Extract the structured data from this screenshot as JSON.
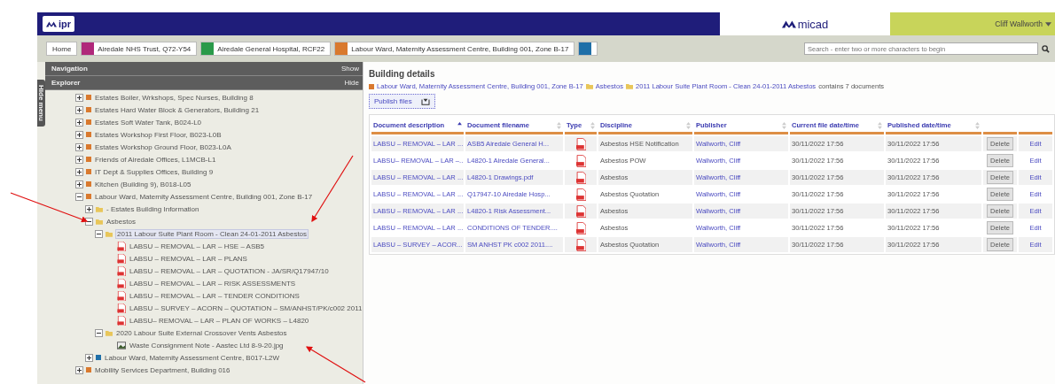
{
  "header": {
    "logo": "ipr",
    "product_logo": "micad",
    "user": "Cliff Wallworth"
  },
  "breadcrumb": {
    "home": "Home",
    "items": [
      {
        "label": "Airedale NHS Trust, Q72-Y54",
        "color": "#b0287a"
      },
      {
        "label": "Airedale General Hospital, RCF22",
        "color": "#2a9a4a"
      },
      {
        "label": "Labour Ward, Maternity Assessment Centre, Building 001, Zone B-17",
        "color": "#d9792e"
      },
      {
        "color": "#1f6fa8"
      }
    ]
  },
  "search": {
    "placeholder": "Search - enter two or more characters to begin"
  },
  "sidebar": {
    "toggle_tab": "Hide menu",
    "navigation": {
      "title": "Navigation",
      "action": "Show"
    },
    "explorer": {
      "title": "Explorer",
      "action": "Hide"
    },
    "tree": [
      {
        "label": "Estates Boiler, Wrkshops, Spec Nurses, Building 8",
        "kind": "building",
        "color": "#d9792e",
        "expanded": false,
        "selected": false
      },
      {
        "label": "Estates Hard Water Block & Generators, Building 21",
        "kind": "building",
        "color": "#d9792e",
        "expanded": false,
        "selected": false
      },
      {
        "label": "Estates Soft Water Tank, B024-L0",
        "kind": "building",
        "color": "#d9792e",
        "expanded": false,
        "selected": false
      },
      {
        "label": "Estates Workshop First Floor, B023-L0B",
        "kind": "building",
        "color": "#d9792e",
        "expanded": false,
        "selected": false
      },
      {
        "label": "Estates Workshop Ground Floor, B023-L0A",
        "kind": "building",
        "color": "#d9792e",
        "expanded": false,
        "selected": false
      },
      {
        "label": "Friends of Airedale Offices, L1MCB-L1",
        "kind": "building",
        "color": "#d9792e",
        "expanded": false,
        "selected": false
      },
      {
        "label": "IT Dept & Supplies Offices, Building 9",
        "kind": "building",
        "color": "#d9792e",
        "expanded": false,
        "selected": false
      },
      {
        "label": "Kitchen (Building 9), B018-L05",
        "kind": "building",
        "color": "#d9792e",
        "expanded": false,
        "selected": false
      },
      {
        "label": "Labour Ward, Maternity Assessment Centre, Building 001, Zone B-17",
        "kind": "building",
        "color": "#d9792e",
        "expanded": true,
        "selected": false,
        "children": [
          {
            "label": "- Estates Building Information",
            "kind": "folder",
            "expanded": false,
            "selected": false
          },
          {
            "label": "Asbestos",
            "kind": "folder",
            "expanded": true,
            "selected": false,
            "children": [
              {
                "label": "2011 Labour Suite Plant Room - Clean 24-01-2011 Asbestos",
                "kind": "folder",
                "expanded": true,
                "selected": true,
                "children": [
                  {
                    "label": "LABSU – REMOVAL – LAR – HSE – ASB5",
                    "kind": "pdf",
                    "selected": false
                  },
                  {
                    "label": "LABSU – REMOVAL – LAR – PLANS",
                    "kind": "pdf",
                    "selected": false
                  },
                  {
                    "label": "LABSU – REMOVAL – LAR – QUOTATION - JA/SR/Q17947/10",
                    "kind": "pdf",
                    "selected": false
                  },
                  {
                    "label": "LABSU – REMOVAL – LAR – RISK ASSESSMENTS",
                    "kind": "pdf",
                    "selected": false
                  },
                  {
                    "label": "LABSU – REMOVAL – LAR – TENDER CONDITIONS",
                    "kind": "pdf",
                    "selected": false
                  },
                  {
                    "label": "LABSU – SURVEY – ACORN – QUOTATION – SM/ANHST/PK/c002 2011",
                    "kind": "pdf",
                    "selected": false
                  },
                  {
                    "label": "LABSU– REMOVAL – LAR – PLAN OF WORKS – L4820",
                    "kind": "pdf",
                    "selected": false
                  }
                ]
              },
              {
                "label": "2020 Labour Suite External Crossover Vents Asbestos",
                "kind": "folder",
                "expanded": true,
                "selected": false,
                "children": [
                  {
                    "label": "Waste Consignment Note - Aastec Ltd 8-9-20.jpg",
                    "kind": "image",
                    "selected": false
                  }
                ]
              }
            ]
          },
          {
            "label": "Labour Ward, Maternity Assessment Centre, B017-L2W",
            "kind": "building",
            "color": "#1f6fa8",
            "expanded": false,
            "selected": false
          }
        ]
      },
      {
        "label": "Mobility Services Department, Building 016",
        "kind": "building",
        "color": "#d9792e",
        "expanded": false,
        "selected": false
      }
    ]
  },
  "details": {
    "title": "Building details",
    "path": [
      {
        "label": "Labour Ward, Maternity Assessment Centre, Building 001, Zone B-17",
        "kind": "building"
      },
      {
        "label": "Asbestos",
        "kind": "folder"
      },
      {
        "label": "2011 Labour Suite Plant Room - Clean 24-01-2011 Asbestos",
        "kind": "folder"
      }
    ],
    "summary": "contains 7 documents",
    "publish_button": "Publish files",
    "table": {
      "columns": [
        {
          "label": "Document description",
          "sorted": true
        },
        {
          "label": "Document filename",
          "sorted": false
        },
        {
          "label": "Type",
          "sorted": false
        },
        {
          "label": "Discipline",
          "sorted": false
        },
        {
          "label": "Publisher",
          "sorted": false
        },
        {
          "label": "Current file date/time",
          "sorted": false
        },
        {
          "label": "Published date/time",
          "sorted": false
        }
      ],
      "rows": [
        {
          "description": "LABSU – REMOVAL – LAR ...",
          "filename": "ASB5 Airedale General H...",
          "discipline": "Asbestos HSE Notification",
          "publisher": "Wallworth, Cliff",
          "current": "30/11/2022 17:56",
          "published": "30/11/2022 17:56",
          "delete": "Delete",
          "edit": "Edit"
        },
        {
          "description": "LABSU– REMOVAL – LAR –...",
          "filename": "L4820-1 Airedale General...",
          "discipline": "Asbestos POW",
          "publisher": "Wallworth, Cliff",
          "current": "30/11/2022 17:56",
          "published": "30/11/2022 17:56",
          "delete": "Delete",
          "edit": "Edit"
        },
        {
          "description": "LABSU – REMOVAL – LAR ...",
          "filename": "L4820-1 Drawings.pdf",
          "discipline": "Asbestos",
          "publisher": "Wallworth, Cliff",
          "current": "30/11/2022 17:56",
          "published": "30/11/2022 17:56",
          "delete": "Delete",
          "edit": "Edit"
        },
        {
          "description": "LABSU – REMOVAL – LAR ...",
          "filename": "Q17947-10 Airedale Hosp...",
          "discipline": "Asbestos Quotation",
          "publisher": "Wallworth, Cliff",
          "current": "30/11/2022 17:56",
          "published": "30/11/2022 17:56",
          "delete": "Delete",
          "edit": "Edit"
        },
        {
          "description": "LABSU – REMOVAL – LAR ...",
          "filename": "L4820-1 Risk Assessment...",
          "discipline": "Asbestos",
          "publisher": "Wallworth, Cliff",
          "current": "30/11/2022 17:56",
          "published": "30/11/2022 17:56",
          "delete": "Delete",
          "edit": "Edit"
        },
        {
          "description": "LABSU – REMOVAL – LAR ...",
          "filename": "CONDITIONS OF TENDER....",
          "discipline": "Asbestos",
          "publisher": "Wallworth, Cliff",
          "current": "30/11/2022 17:56",
          "published": "30/11/2022 17:56",
          "delete": "Delete",
          "edit": "Edit"
        },
        {
          "description": "LABSU – SURVEY – ACOR...",
          "filename": "SM ANHST PK c002 2011....",
          "discipline": "Asbestos Quotation",
          "publisher": "Wallworth, Cliff",
          "current": "30/11/2022 17:56",
          "published": "30/11/2022 17:56",
          "delete": "Delete",
          "edit": "Edit"
        }
      ]
    }
  }
}
